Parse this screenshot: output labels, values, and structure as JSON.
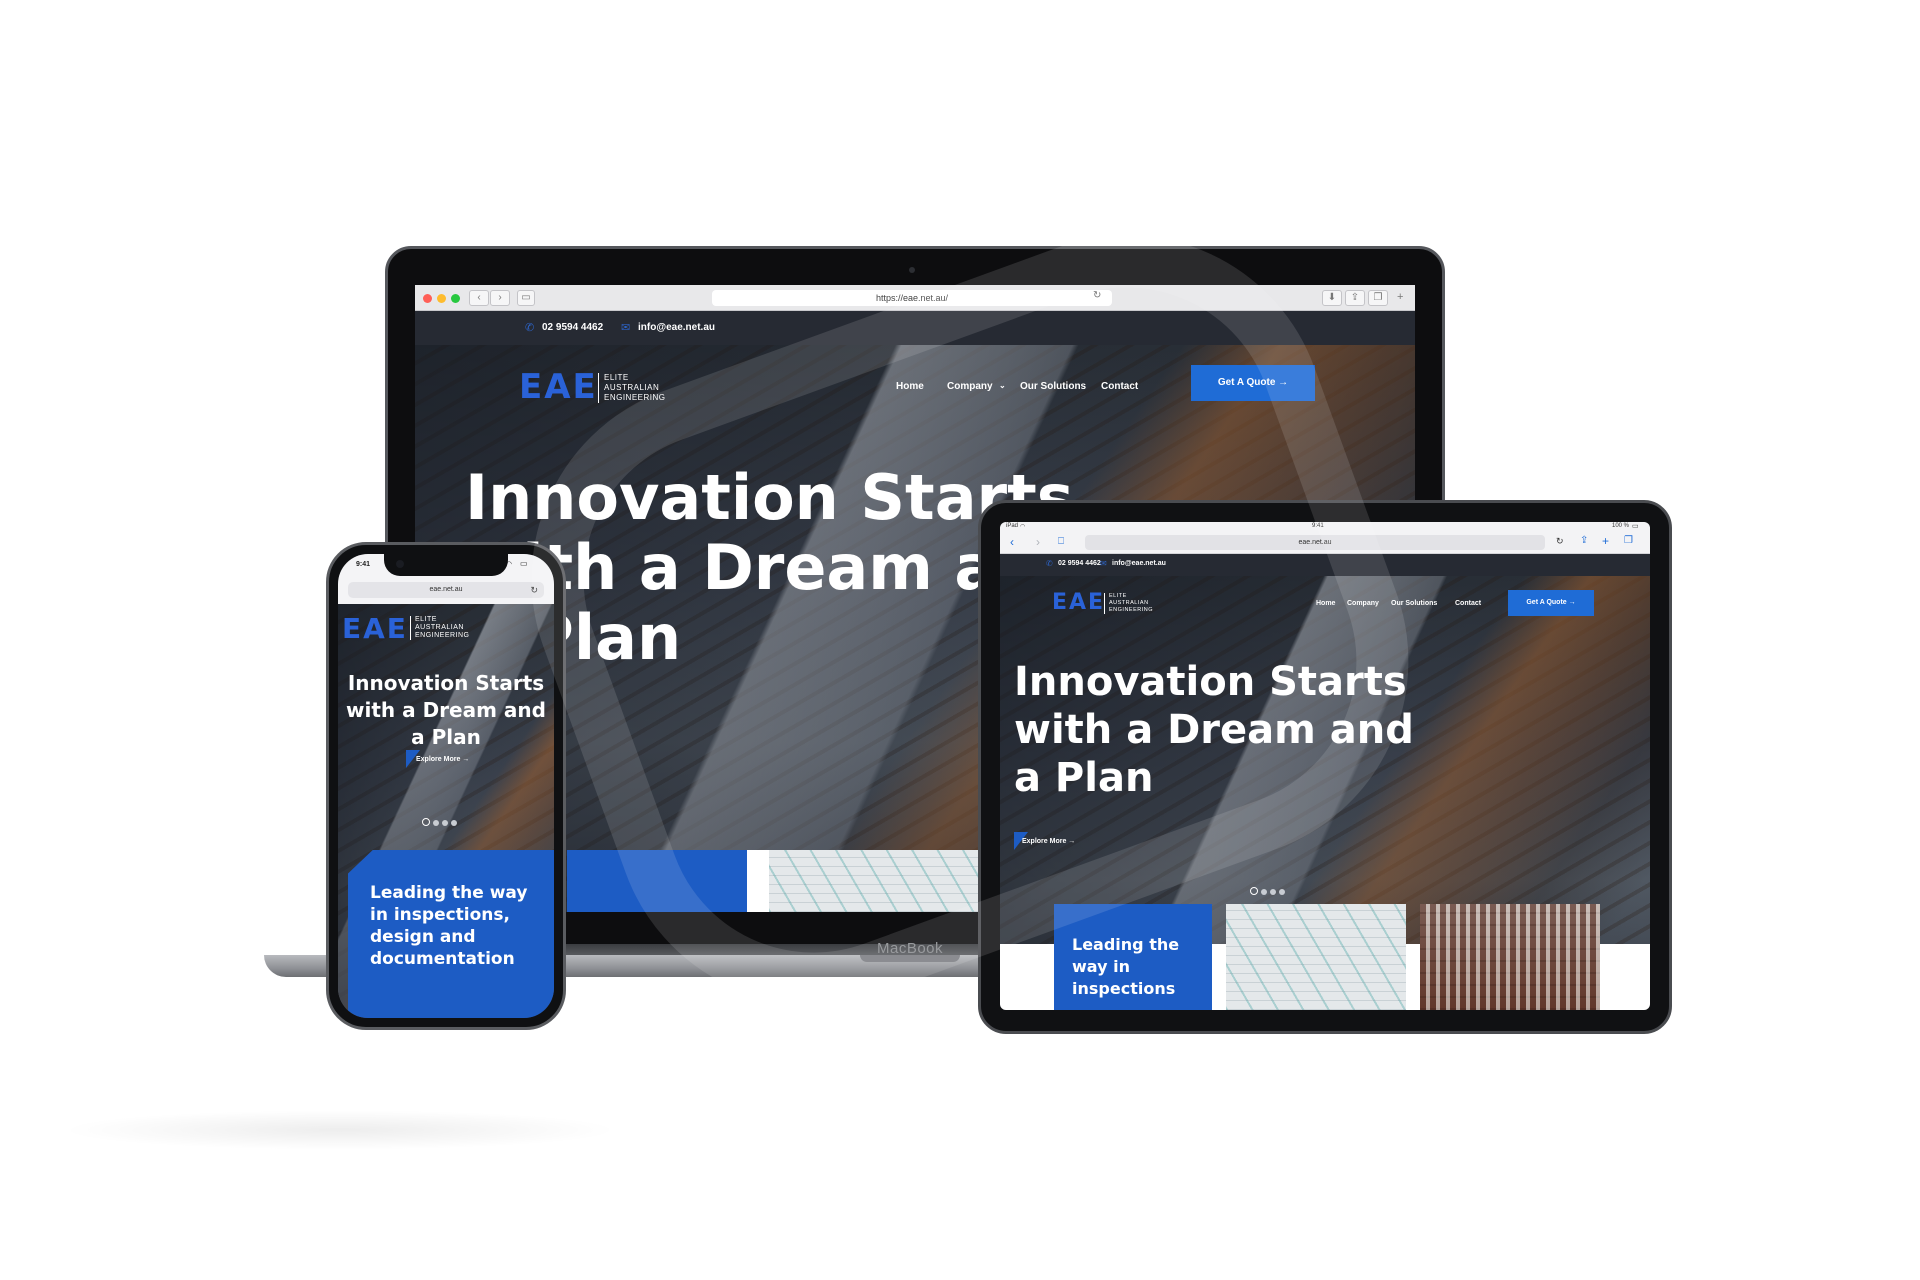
{
  "brand": {
    "logo_letters": "EAE",
    "logo_line1": "ELITE",
    "logo_line2": "AUSTRALIAN",
    "logo_line3": "ENGINEERING",
    "accent_color": "#1d5cc4",
    "dark_bar_color": "#262a33"
  },
  "laptop": {
    "url": "https://eae.net.au/",
    "phone": "02 9594 4462",
    "email": "info@eae.net.au",
    "nav": [
      "Home",
      "Company",
      "Our Solutions",
      "Contact"
    ],
    "cta": "Get A Quote →",
    "hero_line1": "Innovation Starts",
    "hero_line2": "with a Dream and",
    "hero_line3": "a Plan",
    "device_label": "MacBook"
  },
  "tablet": {
    "status_left": "iPad",
    "status_time": "9:41",
    "status_right": "100 %",
    "url": "eae.net.au",
    "phone": "02 9594 4462",
    "email": "info@eae.net.au",
    "nav": [
      "Home",
      "Company",
      "Our Solutions",
      "Contact"
    ],
    "cta": "Get A Quote →",
    "hero_line1": "Innovation Starts",
    "hero_line2": "with a Dream and",
    "hero_line3": "a Plan",
    "explore": "Explore More →",
    "card_line1": "Leading the",
    "card_line2": "way in",
    "card_line3": "inspections"
  },
  "phone": {
    "status_time": "9:41",
    "url": "eae.net.au",
    "hero_line1": "Innovation Starts",
    "hero_line2": "with a Dream and",
    "hero_line3": "a Plan",
    "explore": "Explore More →",
    "card_line1": "Leading the way",
    "card_line2": "in inspections,",
    "card_line3": "design and",
    "card_line4": "documentation"
  },
  "slider": {
    "active_index": 1,
    "total": 4
  },
  "icons": [
    "phone-icon",
    "mail-icon",
    "back-icon",
    "forward-icon",
    "sidebar-icon",
    "reload-icon",
    "download-icon",
    "share-icon",
    "tabs-icon",
    "bookmark-icon",
    "plus-icon",
    "chevron-down-icon",
    "arrow-right-icon",
    "wifi-icon",
    "battery-icon"
  ]
}
